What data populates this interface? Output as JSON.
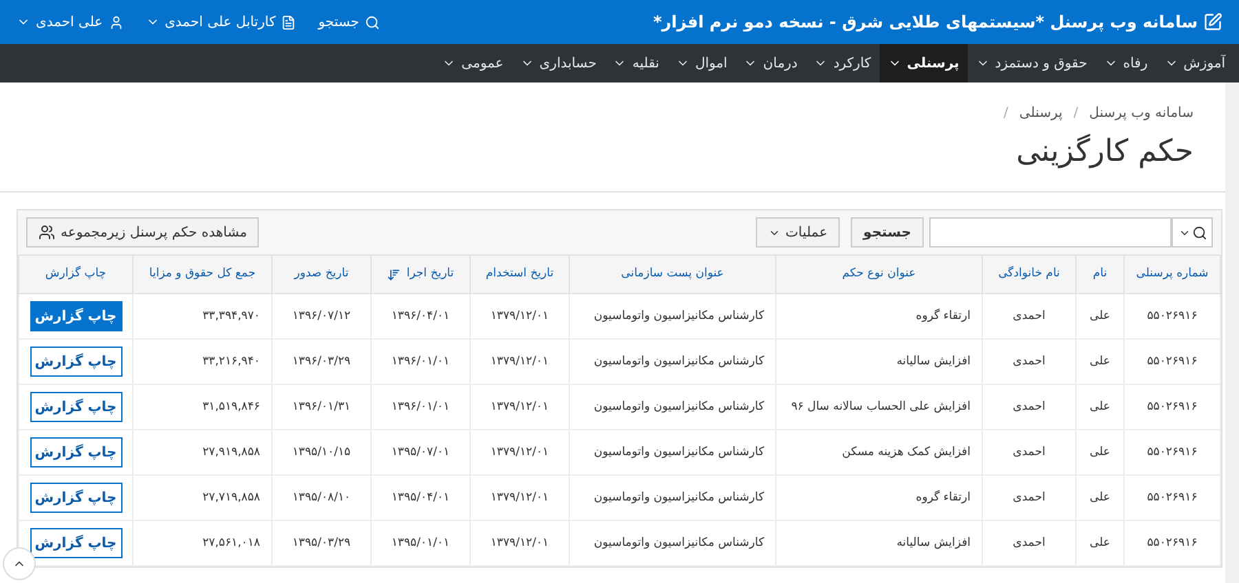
{
  "header": {
    "title": "سامانه وب پرسنل *سیستمهای طلایی شرق - نسخه دمو نرم افزار*",
    "links": [
      {
        "label": "جستجو",
        "kind": "search"
      },
      {
        "label": "کارتابل علی احمدی",
        "kind": "inbox"
      },
      {
        "label": "علی احمدی",
        "kind": "user"
      }
    ]
  },
  "nav": [
    {
      "label": "آموزش",
      "selected": false
    },
    {
      "label": "رفاه",
      "selected": false
    },
    {
      "label": "حقوق و دستمزد",
      "selected": false
    },
    {
      "label": "پرسنلی",
      "selected": true
    },
    {
      "label": "کارکرد",
      "selected": false
    },
    {
      "label": "درمان",
      "selected": false
    },
    {
      "label": "اموال",
      "selected": false
    },
    {
      "label": "نقلیه",
      "selected": false
    },
    {
      "label": "حسابداری",
      "selected": false
    },
    {
      "label": "عمومی",
      "selected": false
    }
  ],
  "breadcrumb": {
    "items": [
      "سامانه وب پرسنل",
      "پرسنلی"
    ],
    "separator": "/"
  },
  "page_title": "حکم کارگزینی",
  "toolbar": {
    "search_button": "جستجو",
    "actions_menu": "عملیات",
    "subordinates_button": "مشاهده حکم پرسنل زیرمجموعه"
  },
  "table": {
    "columns": [
      {
        "label": "شماره پرسنلی",
        "sorted": false
      },
      {
        "label": "نام",
        "sorted": false
      },
      {
        "label": "نام خانوادگی",
        "sorted": false
      },
      {
        "label": "عنوان نوع حکم",
        "sorted": false
      },
      {
        "label": "عنوان پست سازمانی",
        "sorted": false
      },
      {
        "label": "تاریخ استخدام",
        "sorted": false
      },
      {
        "label": "تاریخ اجرا",
        "sorted": true
      },
      {
        "label": "تاریخ صدور",
        "sorted": false
      },
      {
        "label": "جمع کل حقوق و مزایا",
        "sorted": false
      },
      {
        "label": "چاپ گزارش",
        "sorted": false
      }
    ],
    "rows": [
      {
        "cells": [
          "۵۵۰۲۶۹۱۶",
          "علی",
          "احمدی",
          "ارتقاء گروه",
          "کارشناس مکانیزاسیون واتوماسیون",
          "۱۳۷۹/۱۲/۰۱",
          "۱۳۹۶/۰۴/۰۱",
          "۱۳۹۶/۰۷/۱۲",
          "۳۳,۳۹۴,۹۷۰"
        ],
        "button": {
          "label": "چاپ گزارش",
          "selected": true
        }
      },
      {
        "cells": [
          "۵۵۰۲۶۹۱۶",
          "علی",
          "احمدی",
          "افزایش سالیانه",
          "کارشناس مکانیزاسیون واتوماسیون",
          "۱۳۷۹/۱۲/۰۱",
          "۱۳۹۶/۰۱/۰۱",
          "۱۳۹۶/۰۳/۲۹",
          "۳۳,۲۱۶,۹۴۰"
        ],
        "button": {
          "label": "چاپ گزارش",
          "selected": false
        }
      },
      {
        "cells": [
          "۵۵۰۲۶۹۱۶",
          "علی",
          "احمدی",
          "افزایش علی الحساب سالانه سال ۹۶",
          "کارشناس مکانیزاسیون واتوماسیون",
          "۱۳۷۹/۱۲/۰۱",
          "۱۳۹۶/۰۱/۰۱",
          "۱۳۹۶/۰۱/۳۱",
          "۳۱,۵۱۹,۸۴۶"
        ],
        "button": {
          "label": "چاپ گزارش",
          "selected": false
        }
      },
      {
        "cells": [
          "۵۵۰۲۶۹۱۶",
          "علی",
          "احمدی",
          "افزایش کمک هزینه مسکن",
          "کارشناس مکانیزاسیون واتوماسیون",
          "۱۳۷۹/۱۲/۰۱",
          "۱۳۹۵/۰۷/۰۱",
          "۱۳۹۵/۱۰/۱۵",
          "۲۷,۹۱۹,۸۵۸"
        ],
        "button": {
          "label": "چاپ گزارش",
          "selected": false
        }
      },
      {
        "cells": [
          "۵۵۰۲۶۹۱۶",
          "علی",
          "احمدی",
          "ارتقاء گروه",
          "کارشناس مکانیزاسیون واتوماسیون",
          "۱۳۷۹/۱۲/۰۱",
          "۱۳۹۵/۰۴/۰۱",
          "۱۳۹۵/۰۸/۱۰",
          "۲۷,۷۱۹,۸۵۸"
        ],
        "button": {
          "label": "چاپ گزارش",
          "selected": false
        }
      },
      {
        "cells": [
          "۵۵۰۲۶۹۱۶",
          "علی",
          "احمدی",
          "افزایش سالیانه",
          "کارشناس مکانیزاسیون واتوماسیون",
          "۱۳۷۹/۱۲/۰۱",
          "۱۳۹۵/۰۱/۰۱",
          "۱۳۹۵/۰۳/۲۹",
          "۲۷,۵۶۱,۰۱۸"
        ],
        "button": {
          "label": "چاپ گزارش",
          "selected": false
        }
      }
    ]
  }
}
